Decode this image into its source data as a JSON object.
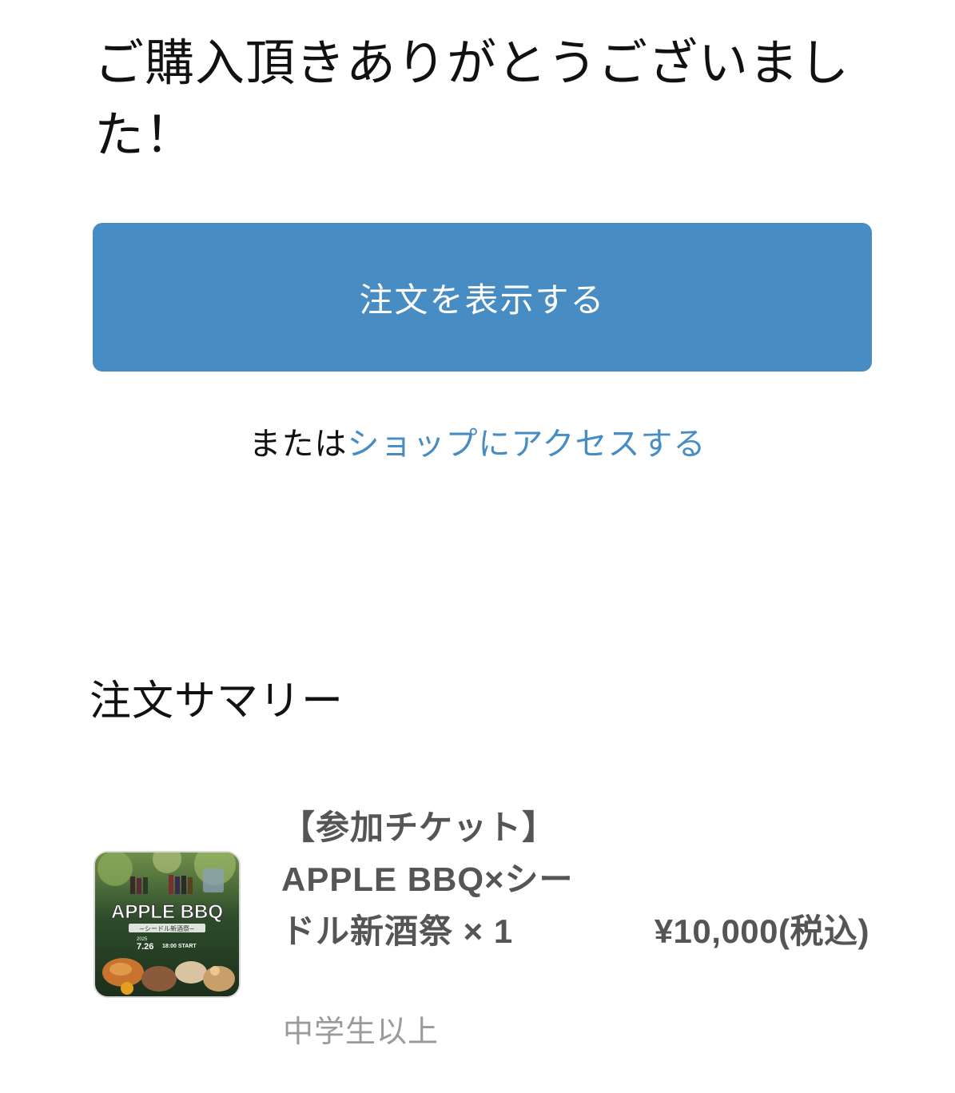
{
  "thank_you": {
    "title": "ご購入頂きありがとうございました！"
  },
  "actions": {
    "view_order_label": "注文を表示する",
    "or_text": "または",
    "shop_link_label": "ショップにアクセスする"
  },
  "summary": {
    "title": "注文サマリー",
    "items": [
      {
        "name": "【参加チケット】APPLE BBQ×シードル新酒祭 × 1",
        "variant": "中学生以上",
        "price": "¥10,000(税込)",
        "thumbnail": {
          "headline": "APPLE BBQ",
          "subtitle": "~シードル新酒祭~",
          "year": "2025",
          "date": "7.26",
          "time": "18:00 START"
        }
      }
    ]
  },
  "colors": {
    "accent": "#478cc2",
    "text": "#111111",
    "muted": "#9a9a9a",
    "product_text": "#555555"
  }
}
